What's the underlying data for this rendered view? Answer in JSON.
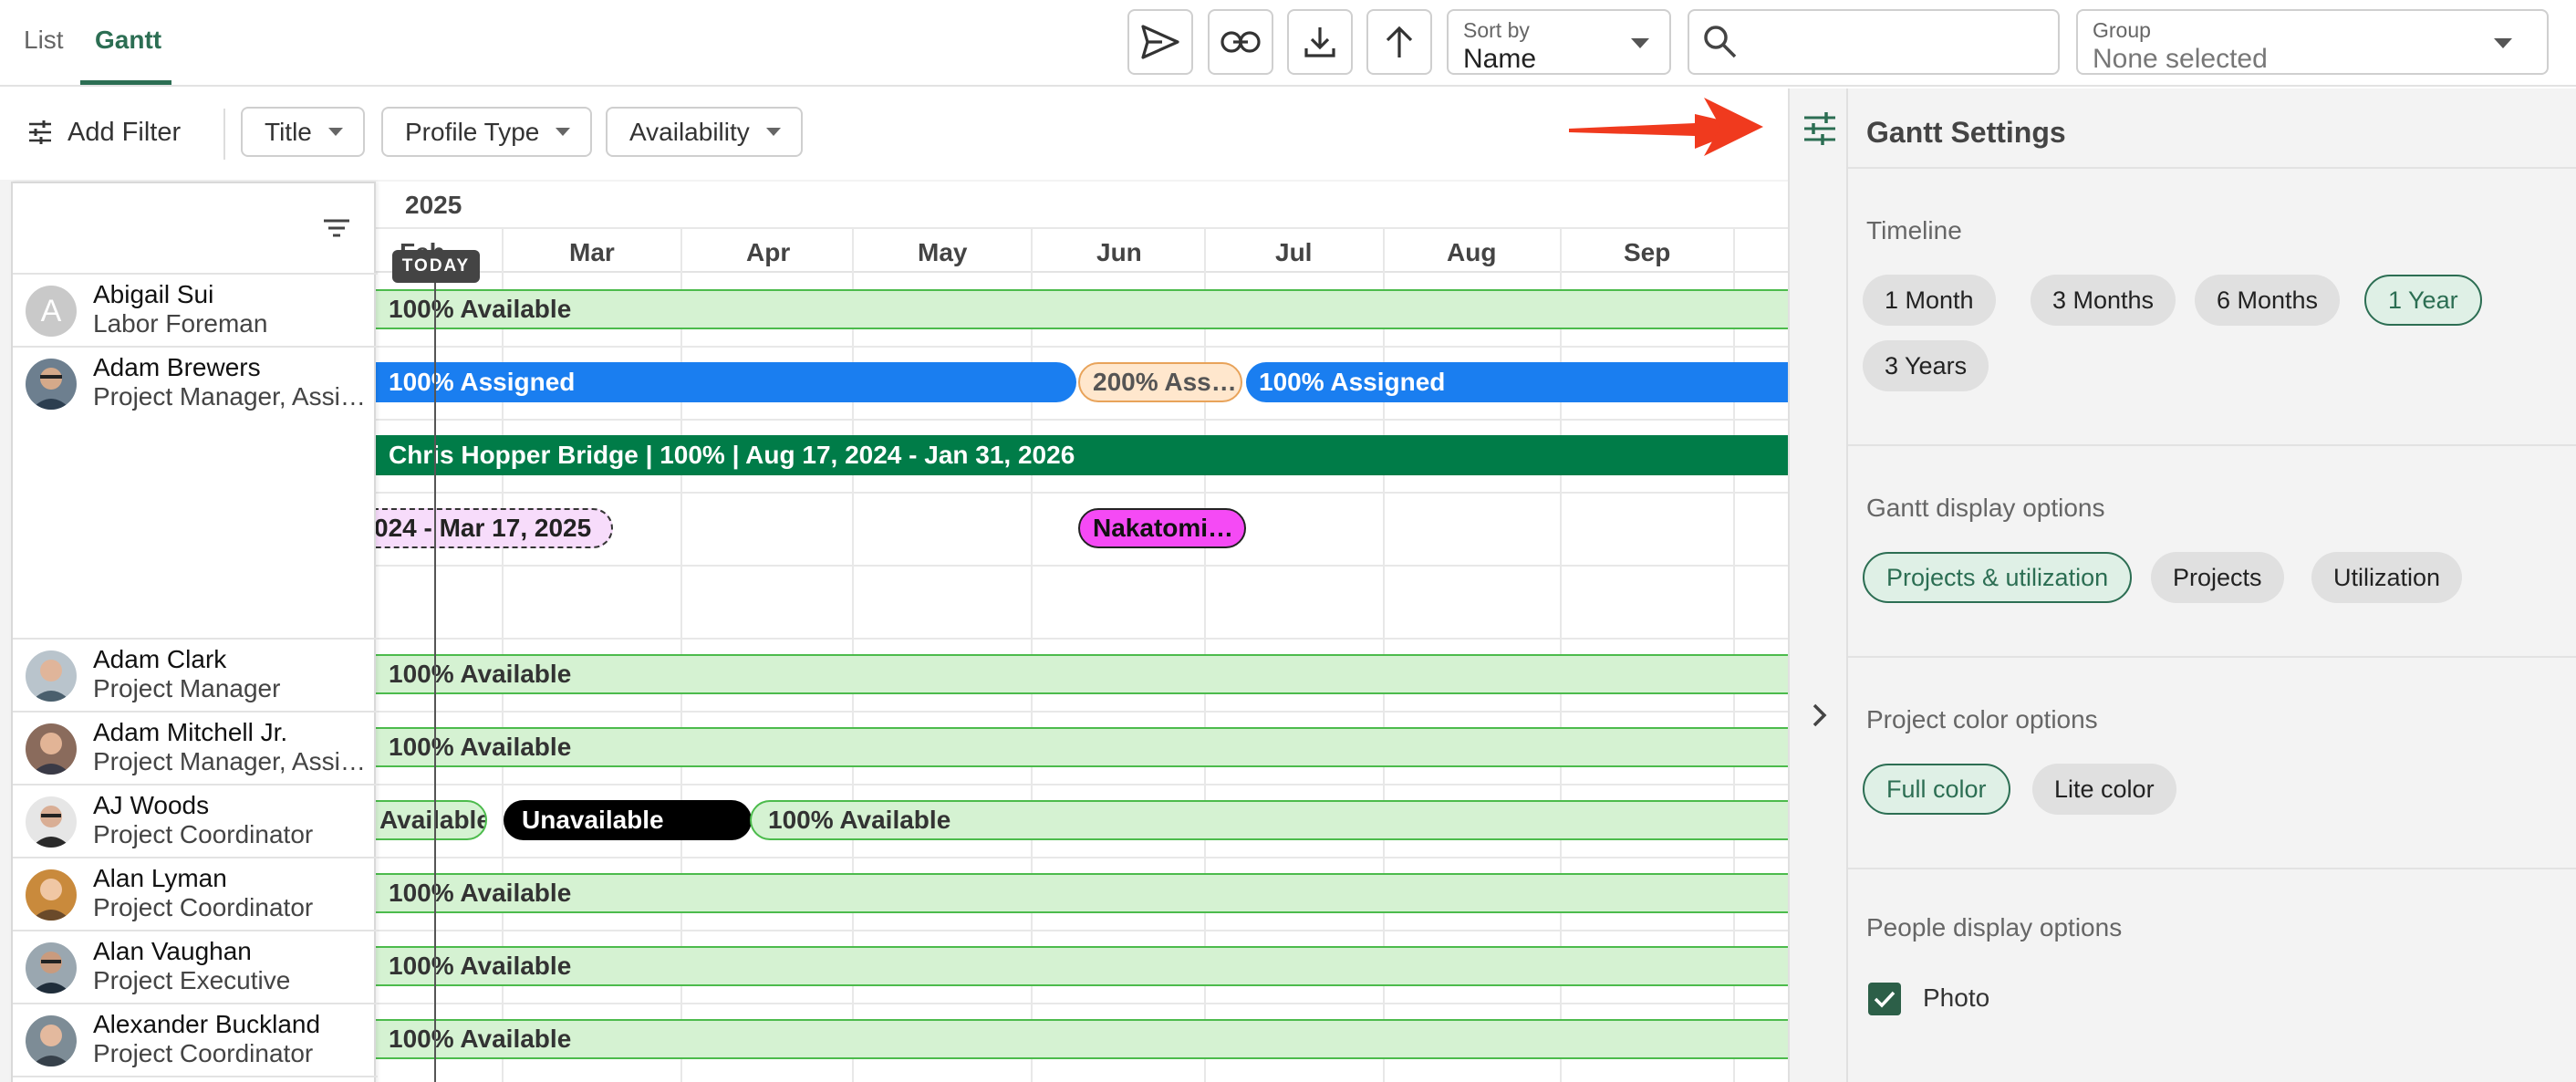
{
  "view_tabs": {
    "list": "List",
    "gantt": "Gantt"
  },
  "toolbar": {
    "sort_by_label": "Sort by",
    "sort_by_value": "Name",
    "search_placeholder": "",
    "group_label": "Group",
    "group_value": "None selected"
  },
  "filters": {
    "add_filter": "Add Filter",
    "items": [
      "Title",
      "Profile Type",
      "Availability"
    ]
  },
  "gantt": {
    "year": "2025",
    "months": [
      "Feb",
      "Mar",
      "Apr",
      "May",
      "Jun",
      "Jul",
      "Aug",
      "Sep"
    ],
    "today": "TODAY",
    "bars": {
      "abigail": "100% Available",
      "adam_b_1": "100% Assigned",
      "adam_b_2": "200% Ass…",
      "adam_b_3": "100% Assigned",
      "project_bridge": "Chris Hopper Bridge | 100% | Aug 17, 2024 - Jan 31, 2026",
      "project_dashed": "024 - Mar 17, 2025",
      "project_nakatomi": "Nakatomi…",
      "adam_clark": "100% Available",
      "adam_mitchell": "100% Available",
      "aj_1": "Available",
      "aj_2": "Unavailable",
      "aj_3": "100% Available",
      "alan_lyman": "100% Available",
      "alan_vaughan": "100% Available",
      "alexander": "100% Available"
    }
  },
  "people": [
    {
      "name": "Abigail Sui",
      "role": "Labor Foreman",
      "avatar": "A"
    },
    {
      "name": "Adam Brewers",
      "role": "Project Manager, Assistant"
    },
    {
      "name": "Adam Clark",
      "role": "Project Manager"
    },
    {
      "name": "Adam Mitchell Jr.",
      "role": "Project Manager, Assistant"
    },
    {
      "name": "AJ Woods",
      "role": "Project Coordinator"
    },
    {
      "name": "Alan Lyman",
      "role": "Project Coordinator"
    },
    {
      "name": "Alan Vaughan",
      "role": "Project Executive"
    },
    {
      "name": "Alexander Buckland",
      "role": "Project Coordinator"
    }
  ],
  "settings": {
    "title": "Gantt Settings",
    "timeline": {
      "title": "Timeline",
      "options": [
        "1 Month",
        "3 Months",
        "6 Months",
        "1 Year",
        "3 Years"
      ],
      "selected": "1 Year"
    },
    "display": {
      "title": "Gantt display options",
      "options": [
        "Projects & utilization",
        "Projects",
        "Utilization"
      ],
      "selected": "Projects & utilization"
    },
    "color": {
      "title": "Project color options",
      "options": [
        "Full color",
        "Lite color"
      ],
      "selected": "Full color"
    },
    "people": {
      "title": "People display options",
      "photo_label": "Photo",
      "photo_checked": true
    }
  },
  "colors": {
    "accent": "#2c6e53",
    "available_fill": "#d5f2d2",
    "assigned": "#1a7ef0",
    "project_green": "#007c48",
    "annotation_arrow": "#f03a1e"
  }
}
